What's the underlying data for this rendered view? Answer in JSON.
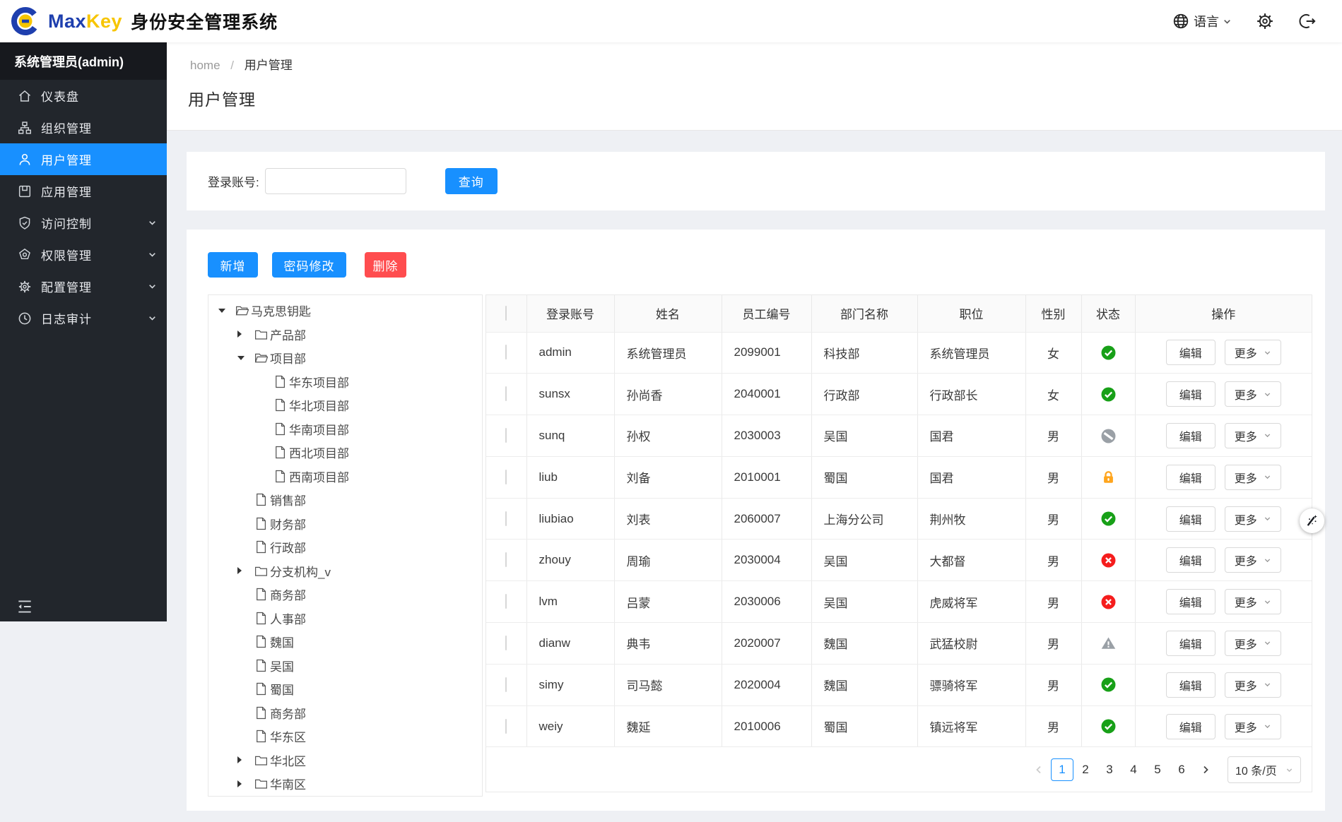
{
  "header": {
    "brand_max": "Max",
    "brand_key": "Key",
    "brand_title": "身份安全管理系统",
    "language_label": "语言"
  },
  "sidebar": {
    "user_label": "系统管理员(admin)",
    "items": [
      {
        "key": "dashboard",
        "label": "仪表盘",
        "icon": "home-icon",
        "active": false,
        "expandable": false
      },
      {
        "key": "org",
        "label": "组织管理",
        "icon": "org-icon",
        "active": false,
        "expandable": false
      },
      {
        "key": "users",
        "label": "用户管理",
        "icon": "user-icon",
        "active": true,
        "expandable": false
      },
      {
        "key": "apps",
        "label": "应用管理",
        "icon": "app-icon",
        "active": false,
        "expandable": false
      },
      {
        "key": "access",
        "label": "访问控制",
        "icon": "shield-icon",
        "active": false,
        "expandable": true
      },
      {
        "key": "permissions",
        "label": "权限管理",
        "icon": "gem-icon",
        "active": false,
        "expandable": true
      },
      {
        "key": "config",
        "label": "配置管理",
        "icon": "gear-icon",
        "active": false,
        "expandable": true
      },
      {
        "key": "audit",
        "label": "日志审计",
        "icon": "clock-icon",
        "active": false,
        "expandable": true
      }
    ]
  },
  "breadcrumb": {
    "home": "home",
    "separator": "/",
    "current": "用户管理"
  },
  "page": {
    "title": "用户管理"
  },
  "search": {
    "label": "登录账号:",
    "value": "",
    "button": "查询"
  },
  "toolbar": {
    "add": "新增",
    "change_password": "密码修改",
    "delete": "删除"
  },
  "tree": {
    "items": [
      {
        "label": "马克思钥匙",
        "level": 0,
        "icon": "folder-open-icon",
        "arrow": "expanded"
      },
      {
        "label": "产品部",
        "level": 1,
        "icon": "folder-icon",
        "arrow": "collapsed"
      },
      {
        "label": "项目部",
        "level": 1,
        "icon": "folder-open-icon",
        "arrow": "expanded"
      },
      {
        "label": "华东项目部",
        "level": 2,
        "icon": "file-icon",
        "arrow": "none"
      },
      {
        "label": "华北项目部",
        "level": 2,
        "icon": "file-icon",
        "arrow": "none"
      },
      {
        "label": "华南项目部",
        "level": 2,
        "icon": "file-icon",
        "arrow": "none"
      },
      {
        "label": "西北项目部",
        "level": 2,
        "icon": "file-icon",
        "arrow": "none"
      },
      {
        "label": "西南项目部",
        "level": 2,
        "icon": "file-icon",
        "arrow": "none"
      },
      {
        "label": "销售部",
        "level": 1,
        "icon": "file-icon",
        "arrow": "none"
      },
      {
        "label": "财务部",
        "level": 1,
        "icon": "file-icon",
        "arrow": "none"
      },
      {
        "label": "行政部",
        "level": 1,
        "icon": "file-icon",
        "arrow": "none"
      },
      {
        "label": "分支机构_v",
        "level": 1,
        "icon": "folder-icon",
        "arrow": "collapsed"
      },
      {
        "label": "商务部",
        "level": 1,
        "icon": "file-icon",
        "arrow": "none"
      },
      {
        "label": "人事部",
        "level": 1,
        "icon": "file-icon",
        "arrow": "none"
      },
      {
        "label": "魏国",
        "level": 1,
        "icon": "file-icon",
        "arrow": "none"
      },
      {
        "label": "吴国",
        "level": 1,
        "icon": "file-icon",
        "arrow": "none"
      },
      {
        "label": "蜀国",
        "level": 1,
        "icon": "file-icon",
        "arrow": "none"
      },
      {
        "label": "商务部",
        "level": 1,
        "icon": "file-icon",
        "arrow": "none"
      },
      {
        "label": "华东区",
        "level": 1,
        "icon": "file-icon",
        "arrow": "none"
      },
      {
        "label": "华北区",
        "level": 1,
        "icon": "folder-icon",
        "arrow": "collapsed"
      },
      {
        "label": "华南区",
        "level": 1,
        "icon": "folder-icon",
        "arrow": "collapsed"
      }
    ]
  },
  "table": {
    "columns": [
      "登录账号",
      "姓名",
      "员工编号",
      "部门名称",
      "职位",
      "性别",
      "状态",
      "操作"
    ],
    "edit_label": "编辑",
    "more_label": "更多",
    "rows": [
      {
        "login": "admin",
        "name": "系统管理员",
        "id": "2099001",
        "dept": "科技部",
        "position": "系统管理员",
        "gender": "女",
        "status": "active"
      },
      {
        "login": "sunsx",
        "name": "孙尚香",
        "id": "2040001",
        "dept": "行政部",
        "position": "行政部长",
        "gender": "女",
        "status": "active"
      },
      {
        "login": "sunq",
        "name": "孙权",
        "id": "2030003",
        "dept": "吴国",
        "position": "国君",
        "gender": "男",
        "status": "disabled"
      },
      {
        "login": "liub",
        "name": "刘备",
        "id": "2010001",
        "dept": "蜀国",
        "position": "国君",
        "gender": "男",
        "status": "locked"
      },
      {
        "login": "liubiao",
        "name": "刘表",
        "id": "2060007",
        "dept": "上海分公司",
        "position": "荆州牧",
        "gender": "男",
        "status": "active"
      },
      {
        "login": "zhouy",
        "name": "周瑜",
        "id": "2030004",
        "dept": "吴国",
        "position": "大都督",
        "gender": "男",
        "status": "inactive"
      },
      {
        "login": "lvm",
        "name": "吕蒙",
        "id": "2030006",
        "dept": "吴国",
        "position": "虎威将军",
        "gender": "男",
        "status": "inactive"
      },
      {
        "login": "dianw",
        "name": "典韦",
        "id": "2020007",
        "dept": "魏国",
        "position": "武猛校尉",
        "gender": "男",
        "status": "warning"
      },
      {
        "login": "simy",
        "name": "司马懿",
        "id": "2020004",
        "dept": "魏国",
        "position": "骠骑将军",
        "gender": "男",
        "status": "active"
      },
      {
        "login": "weiy",
        "name": "魏延",
        "id": "2010006",
        "dept": "蜀国",
        "position": "镇远将军",
        "gender": "男",
        "status": "active"
      }
    ]
  },
  "pagination": {
    "pages": [
      "1",
      "2",
      "3",
      "4",
      "5",
      "6"
    ],
    "current": "1",
    "page_size": "10 条/页"
  },
  "colors": {
    "accent": "#1890ff",
    "danger": "#ff4d4f",
    "status_active": "#18a018",
    "status_inactive": "#f51d1d",
    "status_locked": "#ffa51d",
    "status_gray": "#9aa0a6",
    "brand_blue": "#1e3fae",
    "brand_yellow": "#f7c500"
  }
}
